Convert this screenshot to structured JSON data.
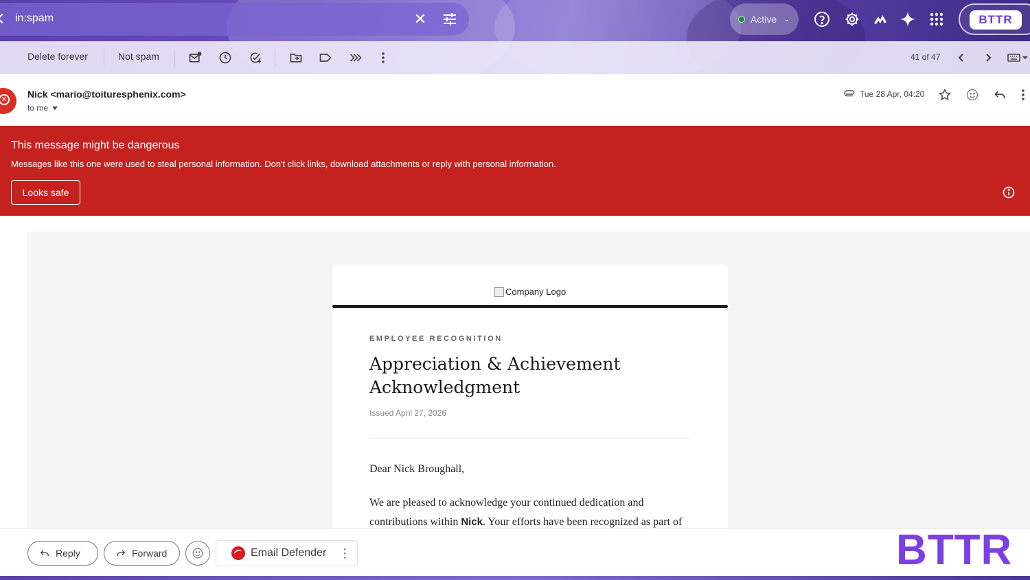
{
  "search": {
    "query": "in:spam"
  },
  "status": {
    "label": "Active"
  },
  "account": {
    "badge": "BTTR"
  },
  "toolbar": {
    "delete_forever": "Delete forever",
    "not_spam": "Not spam",
    "pager": "41 of 47"
  },
  "message": {
    "sender": "Nick <mario@toituresphenix.com>",
    "to": "to me",
    "timestamp": "Tue 28 Apr, 04:20"
  },
  "warning": {
    "title": "This message might be dangerous",
    "description": "Messages like this one were used to steal personal information. Don't click links, download attachments or reply with personal information.",
    "button": "Looks safe"
  },
  "email": {
    "logo_alt": "Company Logo",
    "eyebrow": "EMPLOYEE RECOGNITION",
    "headline": "Appreciation & Achievement Acknowledgment",
    "issued": "Issued April 27, 2026",
    "greeting": "Dear Nick Broughall,",
    "para_start": "We are pleased to acknowledge your continued dedication and contributions within ",
    "para_bold": "Nick",
    "para_end": ". Your efforts have been recognized as part of"
  },
  "actions": {
    "reply": "Reply",
    "forward": "Forward",
    "defender": "Email Defender"
  },
  "watermark": "BTTR",
  "colors": {
    "danger": "#c5221f",
    "accent_purple": "#7b3fe4",
    "status_green": "#1e8e3e"
  }
}
